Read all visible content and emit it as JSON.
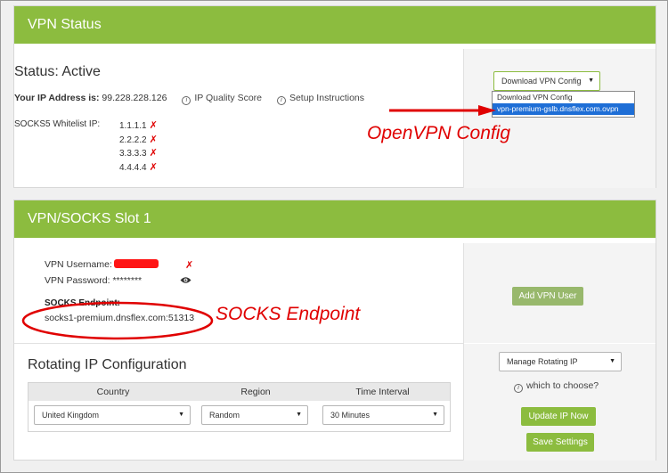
{
  "status_card": {
    "header": "VPN Status",
    "status_title": "Status: Active",
    "ip_label": "Your IP Address is:",
    "ip_value": "99.228.228.126",
    "ip_quality_link": "IP Quality Score",
    "setup_link": "Setup Instructions",
    "whitelist_label": "SOCKS5 Whitelist IP:",
    "whitelist": [
      {
        "ip": "1.1.1.1",
        "mark": "✗"
      },
      {
        "ip": "2.2.2.2",
        "mark": "✗"
      },
      {
        "ip": "3.3.3.3",
        "mark": "✗"
      },
      {
        "ip": "4.4.4.4",
        "mark": "✗"
      }
    ],
    "config_dropdown": {
      "selected": "Download VPN Config",
      "options": [
        "Download VPN Config",
        "vpn-premium-gslb.dnsflex.com.ovpn"
      ],
      "highlighted_index": 1
    }
  },
  "annotations": {
    "openvpn": "OpenVPN Config",
    "socks": "SOCKS Endpoint",
    "color": "#e00000"
  },
  "slot_card": {
    "header": "VPN/SOCKS Slot 1",
    "username_label": "VPN Username:",
    "username_mark": "✗",
    "password_label": "VPN Password:",
    "password_value": "********",
    "endpoint_label": "SOCKS Endpoint:",
    "endpoint_value": "socks1-premium.dnsflex.com:51313",
    "add_user_button": "Add VPN User"
  },
  "rotating": {
    "title": "Rotating IP Configuration",
    "columns": [
      "Country",
      "Region",
      "Time Interval"
    ],
    "country": "United Kingdom",
    "region": "Random",
    "interval": "30 Minutes",
    "manage_select": "Manage Rotating IP",
    "which_choose": "which to choose?",
    "update_button": "Update IP Now",
    "save_button": "Save Settings"
  },
  "colors": {
    "accent": "#8cbc3f",
    "highlight": "#1e6ed6"
  },
  "icons": {
    "info": "info-circle-icon",
    "eye": "eye-icon",
    "caret": "caret-down-icon",
    "cross": "cross-mark-icon"
  }
}
